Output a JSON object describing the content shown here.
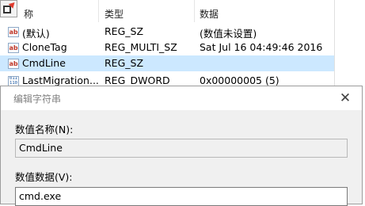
{
  "registry": {
    "columns": {
      "name": "称",
      "type": "类型",
      "data": "数据"
    },
    "rows": [
      {
        "name": "(默认)",
        "type": "REG_SZ",
        "data": "(数值未设置)",
        "icon": "ab-icon"
      },
      {
        "name": "CloneTag",
        "type": "REG_MULTI_SZ",
        "data": "Sat Jul 16 04:49:46 2016",
        "icon": "ab-icon"
      },
      {
        "name": "CmdLine",
        "type": "REG_SZ",
        "data": "",
        "icon": "ab-icon"
      },
      {
        "name": "LastMigration...",
        "type": "REG_DWORD",
        "data": "0x00000005 (5)",
        "icon": "binary-value-icon"
      }
    ],
    "colors": {
      "selected_row": "#cce8ff"
    }
  },
  "dialog": {
    "title": "编辑字符串",
    "value_name_label": "数值名称(N):",
    "value_name": "CmdLine",
    "value_data_label": "数值数据(V):",
    "value_data": "cmd.exe",
    "close_glyph": "✕"
  }
}
